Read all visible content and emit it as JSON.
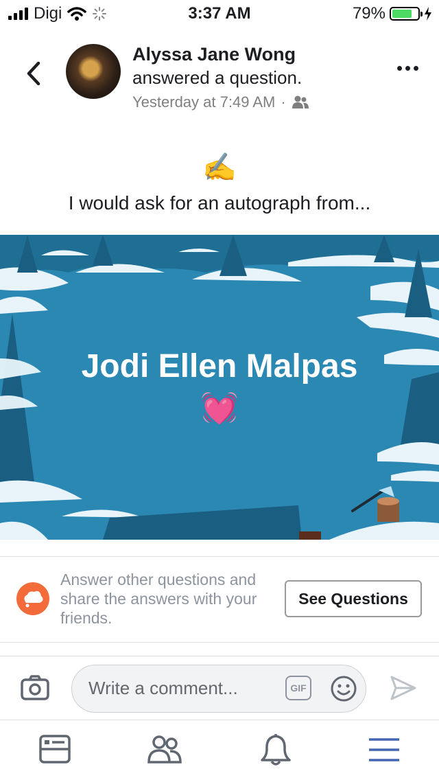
{
  "status": {
    "carrier": "Digi",
    "time": "3:37 AM",
    "battery": "79%",
    "battery_level": 0.79
  },
  "post": {
    "author": "Alyssa Jane Wong",
    "action": "answered a question.",
    "timestamp": "Yesterday at 7:49 AM",
    "separator": "·",
    "emoji": "✍️",
    "question": "I would ask for an autograph from...",
    "answer": "Jodi Ellen Malpas",
    "answer_emoji": "💓"
  },
  "promo": {
    "text": "Answer other questions and share the answers with your friends.",
    "button": "See Questions"
  },
  "composer": {
    "placeholder": "Write a comment...",
    "gif_label": "GIF"
  },
  "colors": {
    "card_bg": "#2b88b3",
    "promo_icon": "#f36b3a",
    "active_tab": "#4267b2"
  }
}
